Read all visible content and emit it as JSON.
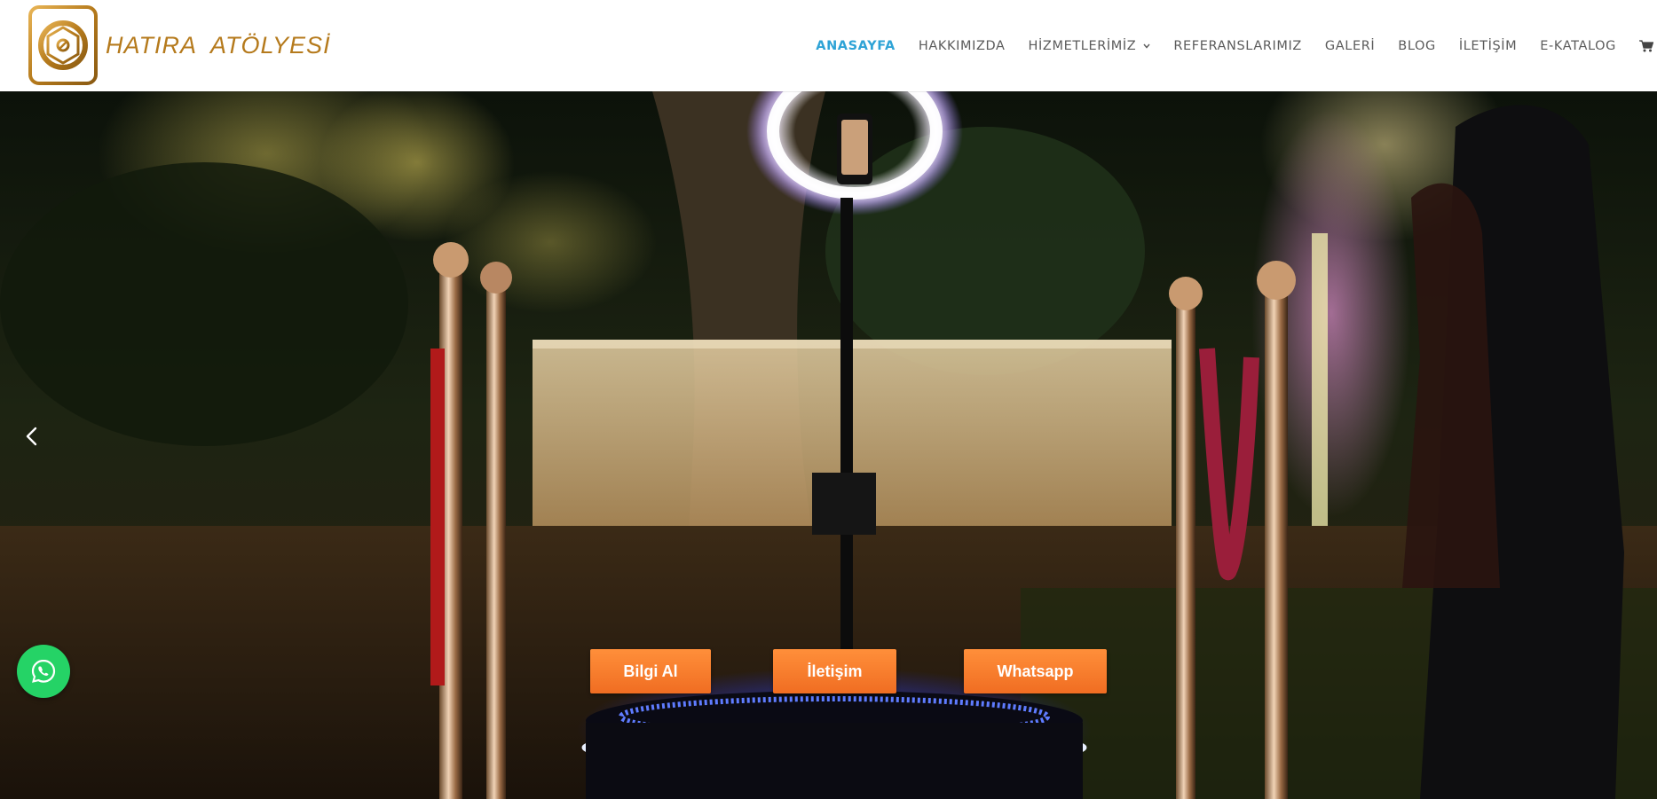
{
  "brand": {
    "name": "HATIRA  ATÖLYESİ",
    "logo_icon": "camera-aperture-icon",
    "color": "#b57a1c"
  },
  "nav": {
    "items": [
      {
        "label": "ANASAYFA",
        "active": true
      },
      {
        "label": "HAKKIMIZDA"
      },
      {
        "label": "HİZMETLERİMİZ",
        "has_dropdown": true
      },
      {
        "label": "REFERANSLARIMIZ"
      },
      {
        "label": "GALERİ"
      },
      {
        "label": "BLOG"
      },
      {
        "label": "İLETİŞİM"
      },
      {
        "label": "E-KATALOG"
      }
    ],
    "cart_icon": "shopping-cart-icon",
    "active_color": "#2ea3d6",
    "text_color": "#5b5b5b"
  },
  "hero": {
    "prev_icon": "chevron-left-icon",
    "buttons": [
      {
        "label": "Bilgi Al"
      },
      {
        "label": "İletişim"
      },
      {
        "label": "Whatsapp"
      }
    ],
    "button_color": "#f47b2a"
  },
  "floating": {
    "whatsapp_icon": "whatsapp-icon",
    "color": "#25d366"
  }
}
